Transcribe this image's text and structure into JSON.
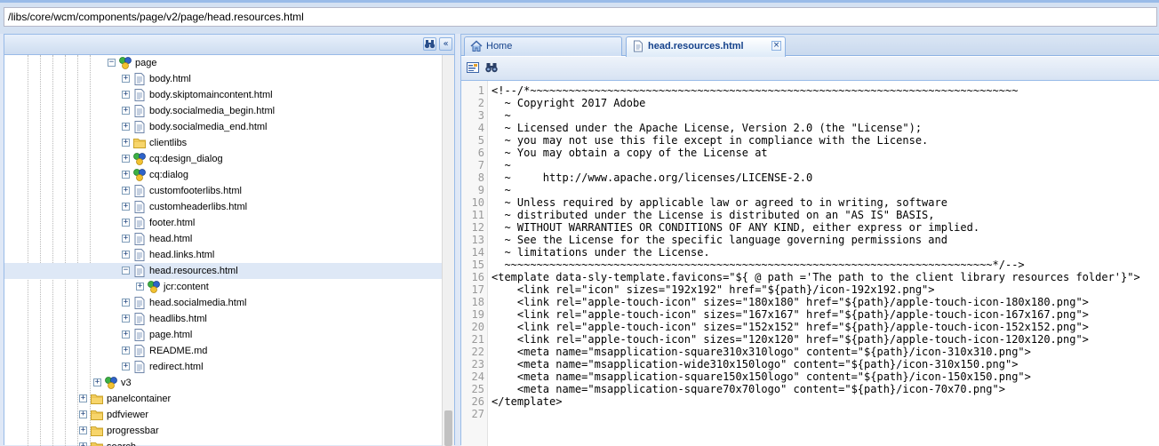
{
  "path_bar": {
    "value": "/libs/core/wcm/components/page/v2/page/head.resources.html"
  },
  "tree_panel": {
    "header_buttons": [
      {
        "name": "binoculars-icon"
      },
      {
        "name": "collapse-left-icon",
        "glyph": "«"
      }
    ],
    "items": [
      {
        "label": "page",
        "icon": "component-icon",
        "toggle": "−",
        "level": 0
      },
      {
        "label": "body.html",
        "icon": "file-icon",
        "toggle": "+",
        "level": 1
      },
      {
        "label": "body.skiptomaincontent.html",
        "icon": "file-icon",
        "toggle": "+",
        "level": 1
      },
      {
        "label": "body.socialmedia_begin.html",
        "icon": "file-icon",
        "toggle": "+",
        "level": 1
      },
      {
        "label": "body.socialmedia_end.html",
        "icon": "file-icon",
        "toggle": "+",
        "level": 1
      },
      {
        "label": "clientlibs",
        "icon": "folder-icon",
        "toggle": "+",
        "level": 1
      },
      {
        "label": "cq:design_dialog",
        "icon": "component-icon",
        "toggle": "+",
        "level": 1
      },
      {
        "label": "cq:dialog",
        "icon": "component-icon",
        "toggle": "+",
        "level": 1
      },
      {
        "label": "customfooterlibs.html",
        "icon": "file-icon",
        "toggle": "+",
        "level": 1
      },
      {
        "label": "customheaderlibs.html",
        "icon": "file-icon",
        "toggle": "+",
        "level": 1
      },
      {
        "label": "footer.html",
        "icon": "file-icon",
        "toggle": "+",
        "level": 1
      },
      {
        "label": "head.html",
        "icon": "file-icon",
        "toggle": "+",
        "level": 1
      },
      {
        "label": "head.links.html",
        "icon": "file-icon",
        "toggle": "+",
        "level": 1
      },
      {
        "label": "head.resources.html",
        "icon": "file-icon",
        "toggle": "−",
        "level": 1,
        "selected": true
      },
      {
        "label": "jcr:content",
        "icon": "component-icon",
        "toggle": "+",
        "level": 2
      },
      {
        "label": "head.socialmedia.html",
        "icon": "file-icon",
        "toggle": "+",
        "level": 1
      },
      {
        "label": "headlibs.html",
        "icon": "file-icon",
        "toggle": "+",
        "level": 1
      },
      {
        "label": "page.html",
        "icon": "file-icon",
        "toggle": "+",
        "level": 1
      },
      {
        "label": "README.md",
        "icon": "file-icon",
        "toggle": "+",
        "level": 1
      },
      {
        "label": "redirect.html",
        "icon": "file-icon",
        "toggle": "+",
        "level": 1
      },
      {
        "label": "v3",
        "icon": "component-icon",
        "toggle": "+",
        "level": -1
      },
      {
        "label": "panelcontainer",
        "icon": "folder-icon",
        "toggle": "+",
        "level": -2
      },
      {
        "label": "pdfviewer",
        "icon": "folder-icon",
        "toggle": "+",
        "level": -2
      },
      {
        "label": "progressbar",
        "icon": "folder-icon",
        "toggle": "+",
        "level": -2
      },
      {
        "label": "search",
        "icon": "folder-icon",
        "toggle": "+",
        "level": -2
      }
    ]
  },
  "editor_panel": {
    "tabs": [
      {
        "label": "Home",
        "icon": "home-icon",
        "active": false
      },
      {
        "label": "head.resources.html",
        "icon": "file-icon",
        "active": true,
        "closable": true
      }
    ],
    "toolbar": [
      {
        "name": "format-icon"
      },
      {
        "name": "search-icon"
      }
    ],
    "code_lines": [
      "<!--/*~~~~~~~~~~~~~~~~~~~~~~~~~~~~~~~~~~~~~~~~~~~~~~~~~~~~~~~~~~~~~~~~~~~~~~~~~~~~",
      "  ~ Copyright 2017 Adobe",
      "  ~",
      "  ~ Licensed under the Apache License, Version 2.0 (the \"License\");",
      "  ~ you may not use this file except in compliance with the License.",
      "  ~ You may obtain a copy of the License at",
      "  ~",
      "  ~     http://www.apache.org/licenses/LICENSE-2.0",
      "  ~",
      "  ~ Unless required by applicable law or agreed to in writing, software",
      "  ~ distributed under the License is distributed on an \"AS IS\" BASIS,",
      "  ~ WITHOUT WARRANTIES OR CONDITIONS OF ANY KIND, either express or implied.",
      "  ~ See the License for the specific language governing permissions and",
      "  ~ limitations under the License.",
      "  ~~~~~~~~~~~~~~~~~~~~~~~~~~~~~~~~~~~~~~~~~~~~~~~~~~~~~~~~~~~~~~~~~~~~~~~~~~~~*/-->",
      "<template data-sly-template.favicons=\"${ @ path ='The path to the client library resources folder'}\">",
      "    <link rel=\"icon\" sizes=\"192x192\" href=\"${path}/icon-192x192.png\">",
      "    <link rel=\"apple-touch-icon\" sizes=\"180x180\" href=\"${path}/apple-touch-icon-180x180.png\">",
      "    <link rel=\"apple-touch-icon\" sizes=\"167x167\" href=\"${path}/apple-touch-icon-167x167.png\">",
      "    <link rel=\"apple-touch-icon\" sizes=\"152x152\" href=\"${path}/apple-touch-icon-152x152.png\">",
      "    <link rel=\"apple-touch-icon\" sizes=\"120x120\" href=\"${path}/apple-touch-icon-120x120.png\">",
      "    <meta name=\"msapplication-square310x310logo\" content=\"${path}/icon-310x310.png\">",
      "    <meta name=\"msapplication-wide310x150logo\" content=\"${path}/icon-310x150.png\">",
      "    <meta name=\"msapplication-square150x150logo\" content=\"${path}/icon-150x150.png\">",
      "    <meta name=\"msapplication-square70x70logo\" content=\"${path}/icon-70x70.png\">",
      "</template>",
      ""
    ]
  },
  "colors": {
    "panel_border": "#99bbe8",
    "header_text": "#15428b",
    "selection": "#dee8f6",
    "background": "#dfe8f6"
  }
}
